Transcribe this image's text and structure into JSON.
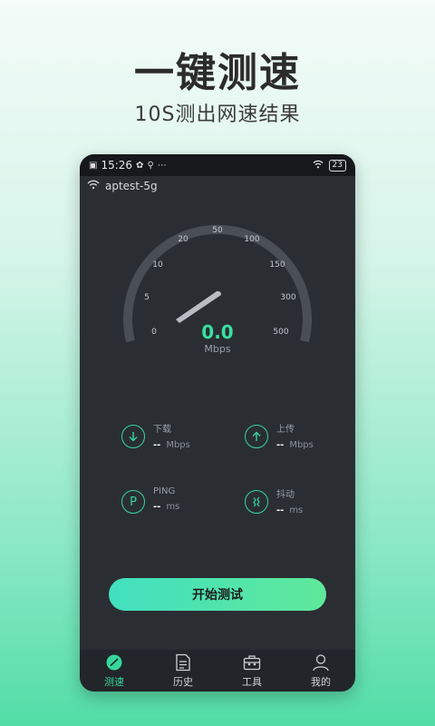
{
  "headline": "一键测速",
  "subline": "10S测出网速结果",
  "status_bar": {
    "time": "15:26",
    "battery": "23"
  },
  "network": {
    "ssid": "aptest-5g"
  },
  "gauge": {
    "ticks": [
      "0",
      "5",
      "10",
      "20",
      "50",
      "100",
      "150",
      "300",
      "500"
    ],
    "value": "0.0",
    "unit": "Mbps"
  },
  "metrics": {
    "download": {
      "label": "下载",
      "value": "--",
      "unit": "Mbps"
    },
    "upload": {
      "label": "上传",
      "value": "--",
      "unit": "Mbps"
    },
    "ping": {
      "label": "PING",
      "value": "--",
      "unit": "ms",
      "icon_letter": "P"
    },
    "jitter": {
      "label": "抖动",
      "value": "--",
      "unit": "ms"
    }
  },
  "start_button": "开始测试",
  "tabs": [
    {
      "label": "测速",
      "icon": "speedometer-icon",
      "active": true
    },
    {
      "label": "历史",
      "icon": "document-icon",
      "active": false
    },
    {
      "label": "工具",
      "icon": "toolbox-icon",
      "active": false
    },
    {
      "label": "我的",
      "icon": "user-icon",
      "active": false
    }
  ],
  "colors": {
    "accent": "#35d69b",
    "phone_bg": "#2a2e33"
  }
}
